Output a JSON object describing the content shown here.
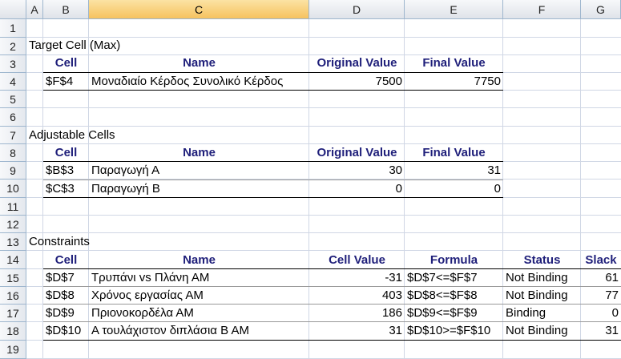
{
  "columns": [
    "A",
    "B",
    "C",
    "D",
    "E",
    "F",
    "G"
  ],
  "rows": [
    "1",
    "2",
    "3",
    "4",
    "5",
    "6",
    "7",
    "8",
    "9",
    "10",
    "11",
    "12",
    "13",
    "14",
    "15",
    "16",
    "17",
    "18",
    "19"
  ],
  "target": {
    "title": "Target Cell (Max)",
    "headers": [
      "Cell",
      "Name",
      "Original Value",
      "Final Value"
    ],
    "row": {
      "cell": "$F$4",
      "name": "Μοναδιαίο Κέρδος Συνολικό Κέρδος",
      "original": "7500",
      "final": "7750"
    }
  },
  "adjustable": {
    "title": "Adjustable Cells",
    "headers": [
      "Cell",
      "Name",
      "Original Value",
      "Final Value"
    ],
    "rows": [
      {
        "cell": "$B$3",
        "name": "Παραγωγή Α",
        "original": "30",
        "final": "31"
      },
      {
        "cell": "$C$3",
        "name": "Παραγωγή Β",
        "original": "0",
        "final": "0"
      }
    ]
  },
  "constraints": {
    "title": "Constraints",
    "headers": [
      "Cell",
      "Name",
      "Cell Value",
      "Formula",
      "Status",
      "Slack"
    ],
    "rows": [
      {
        "cell": "$D$7",
        "name": "Τρυπάνι vs Πλάνη ΑΜ",
        "value": "-31",
        "formula": "$D$7<=$F$7",
        "status": "Not Binding",
        "slack": "61"
      },
      {
        "cell": "$D$8",
        "name": "Χρόνος εργασίας ΑΜ",
        "value": "403",
        "formula": "$D$8<=$F$8",
        "status": "Not Binding",
        "slack": "77"
      },
      {
        "cell": "$D$9",
        "name": "Πριονοκορδέλα ΑΜ",
        "value": "186",
        "formula": "$D$9<=$F$9",
        "status": "Binding",
        "slack": "0"
      },
      {
        "cell": "$D$10",
        "name": "Α τουλάχιστον διπλάσια Β ΑΜ",
        "value": "31",
        "formula": "$D$10>=$F$10",
        "status": "Not Binding",
        "slack": "31"
      }
    ]
  }
}
